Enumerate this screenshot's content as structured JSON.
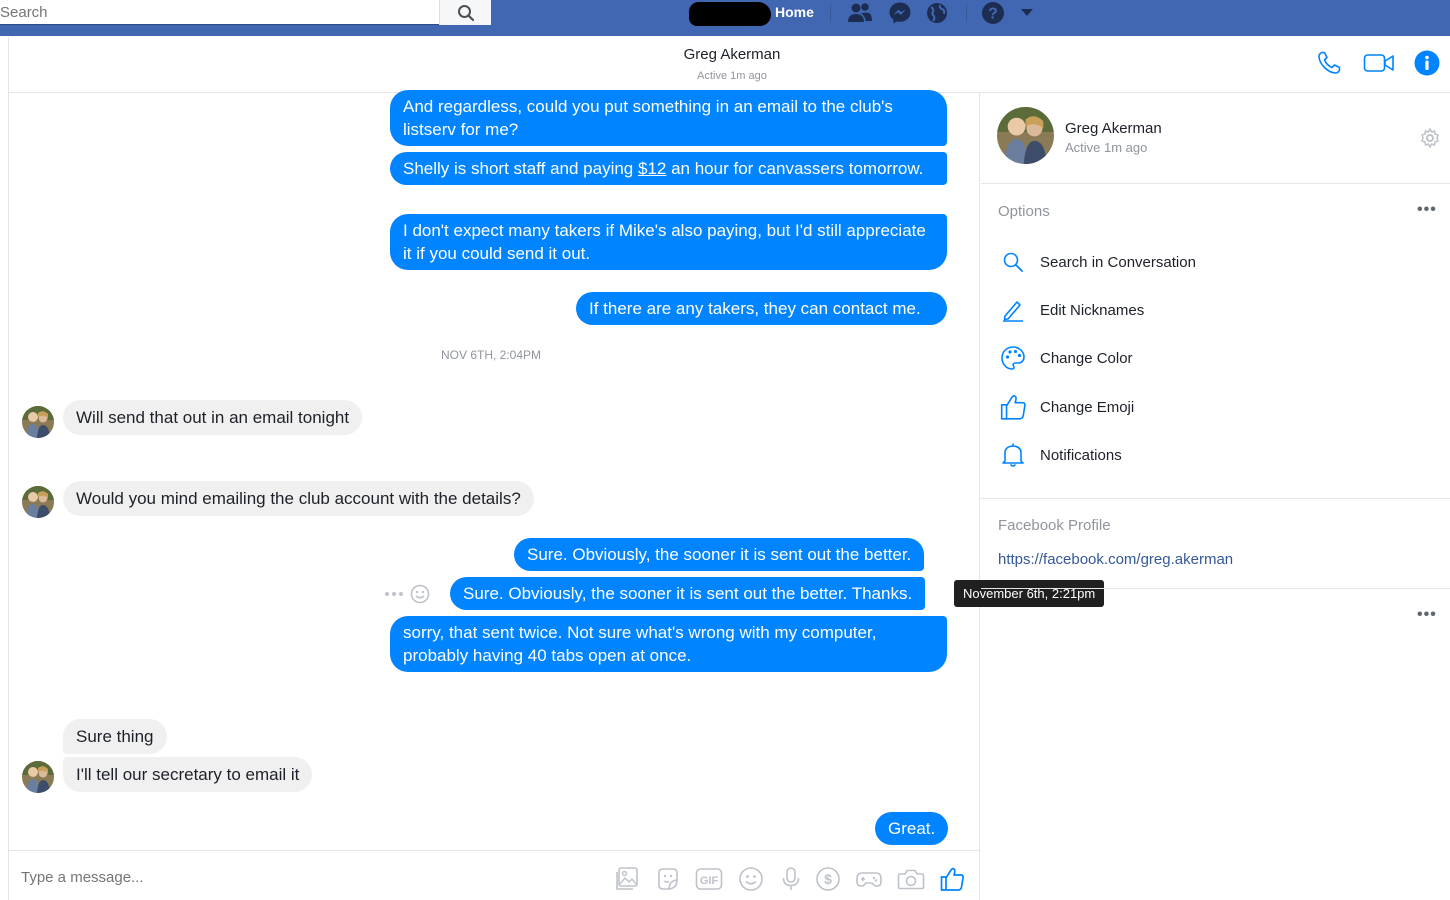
{
  "topbar": {
    "search_placeholder": "Search",
    "home_label": "Home",
    "icons": [
      "search-icon",
      "friend-requests-icon",
      "messenger-icon",
      "globe-icon",
      "help-icon",
      "caret-down-icon"
    ]
  },
  "conversation": {
    "contact_name": "Greg Akerman",
    "contact_status": "Active 1m ago",
    "header_icons": [
      "phone-icon",
      "video-icon",
      "info-icon"
    ]
  },
  "messages": {
    "out_1": "And regardless, could you put something in an email to the club's listserv for me?",
    "out_2_pre": "Shelly is short staff and paying ",
    "out_2_link": "$12",
    "out_2_post": " an hour for canvassers tomorrow.",
    "out_3": "I don't expect many takers if Mike's also paying, but I'd still appreciate it if you could send it out.",
    "out_4": "If there are any takers, they can contact me.",
    "timestamp_1": "NOV 6TH, 2:04PM",
    "in_1": "Will send that out in an email tonight",
    "in_2": "Would you mind emailing the club account with the details?",
    "out_5": "Sure. Obviously, the sooner it is sent out the better.",
    "out_6": "Sure. Obviously, the sooner it is sent out the better. Thanks.",
    "out_6_tooltip": "November 6th, 2:21pm",
    "out_7": "sorry, that sent twice. Not sure what's wrong with my computer, probably having 40 tabs open at once.",
    "in_3": "Sure thing",
    "in_4": "I'll tell our secretary to email it",
    "out_8": "Great."
  },
  "composer": {
    "placeholder": "Type a message...",
    "icons": [
      "photo-icon",
      "sticker-icon",
      "gif-icon",
      "emoji-icon",
      "microphone-icon",
      "payment-icon",
      "game-icon",
      "camera-icon",
      "like-icon"
    ],
    "gif_text": "GIF"
  },
  "info_panel": {
    "name": "Greg Akerman",
    "status": "Active 1m ago",
    "options_title": "Options",
    "options": [
      {
        "label": "Search in Conversation",
        "icon": "search-icon"
      },
      {
        "label": "Edit Nicknames",
        "icon": "pencil-icon"
      },
      {
        "label": "Change Color",
        "icon": "palette-icon"
      },
      {
        "label": "Change Emoji",
        "icon": "thumbs-up-icon"
      },
      {
        "label": "Notifications",
        "icon": "bell-icon"
      }
    ],
    "profile_title": "Facebook Profile",
    "profile_url": "https://facebook.com/greg.akerman",
    "more_label": "•••"
  },
  "colors": {
    "brand_blue": "#4267b2",
    "messenger_blue": "#0084ff",
    "incoming_bubble": "#f1f0f0"
  }
}
